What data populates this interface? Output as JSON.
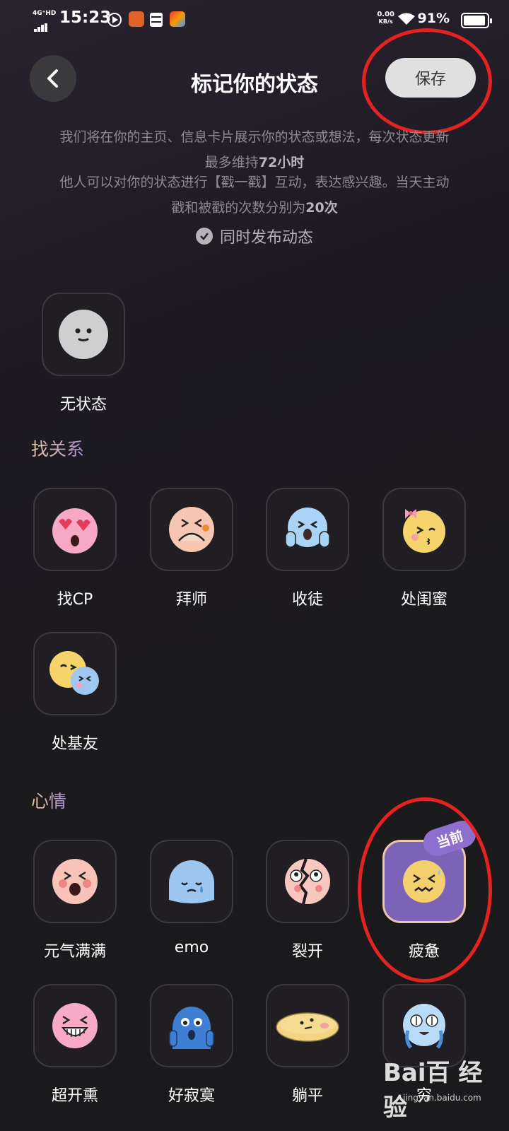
{
  "status_bar": {
    "network": "4G⁺HD",
    "time": "15:23",
    "speed_value": "0.00",
    "speed_unit": "KB/s",
    "battery": "91%",
    "battery_level": 0.91
  },
  "header": {
    "title": "标记你的状态",
    "save_label": "保存"
  },
  "description": {
    "line1": "我们将在你的主页、信息卡片展示你的状态或想法，每次状态更新",
    "line2_prefix": "最多维持",
    "line2_bold": "72小时",
    "line3": "他人可以对你的状态进行【戳一戳】互动，表达感兴趣。当天主动",
    "line4_prefix": "戳和被戳的次数分别为",
    "line4_bold": "20次",
    "sync_label": "同时发布动态"
  },
  "no_status": {
    "label": "无状态"
  },
  "sections": [
    {
      "title": "找关系",
      "items": [
        {
          "label": "找CP",
          "icon": "heart-eyes-icon"
        },
        {
          "label": "拜师",
          "icon": "bowing-icon"
        },
        {
          "label": "收徒",
          "icon": "crying-scared-icon"
        },
        {
          "label": "处闺蜜",
          "icon": "kiss-bow-icon"
        },
        {
          "label": "处基友",
          "icon": "two-friends-icon"
        }
      ]
    },
    {
      "title": "心情",
      "items": [
        {
          "label": "元气满满",
          "icon": "energetic-icon"
        },
        {
          "label": "emo",
          "icon": "sad-tear-icon"
        },
        {
          "label": "裂开",
          "icon": "cracked-face-icon"
        },
        {
          "label": "疲惫",
          "icon": "tired-icon",
          "current": true,
          "badge": "当前"
        },
        {
          "label": "超开熏",
          "icon": "big-grin-icon"
        },
        {
          "label": "好寂寞",
          "icon": "lonely-blue-icon"
        },
        {
          "label": "躺平",
          "icon": "lying-flat-icon"
        },
        {
          "label": "穷",
          "icon": "money-eyes-icon"
        }
      ]
    }
  ],
  "watermark": {
    "logo": "Bai百 经验",
    "sub": "jingyan.baidu.com"
  },
  "colors": {
    "accent": "#7c63b8",
    "annotation": "#e32222",
    "badge": "#8e6fd0"
  }
}
